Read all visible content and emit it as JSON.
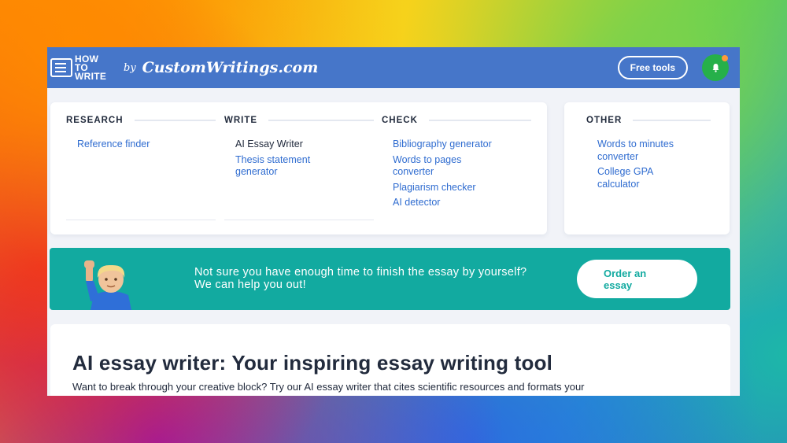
{
  "header": {
    "logo_howto": "HOW to WRITE",
    "logo_by": "by",
    "logo_brand": "CustomWritings.com",
    "free_tools_label": "Free tools"
  },
  "menu": {
    "research": {
      "title": "RESEARCH",
      "items": [
        "Reference finder"
      ]
    },
    "write": {
      "title": "WRITE",
      "items": [
        "AI Essay Writer",
        "Thesis statement generator"
      ]
    },
    "check": {
      "title": "CHECK",
      "items": [
        "Bibliography generator",
        "Words to pages converter",
        "Plagiarism checker",
        "AI detector"
      ]
    },
    "other": {
      "title": "OTHER",
      "items": [
        "Words to minutes converter",
        "College GPA calculator"
      ]
    }
  },
  "banner": {
    "line1": "Not sure you have enough time to finish the essay by yourself?",
    "line2": "We can help you out!",
    "order_label_1": "Order an",
    "order_label_2": "essay"
  },
  "content": {
    "title": "AI essay writer: Your inspiring essay writing tool",
    "intro": "Want to break through your creative block? Try our AI essay writer that cites scientific resources and formats your"
  },
  "colors": {
    "topbar": "#4676c9",
    "link": "#2f6cd0",
    "banner": "#12aaa0",
    "notification_button": "#26b04a"
  }
}
